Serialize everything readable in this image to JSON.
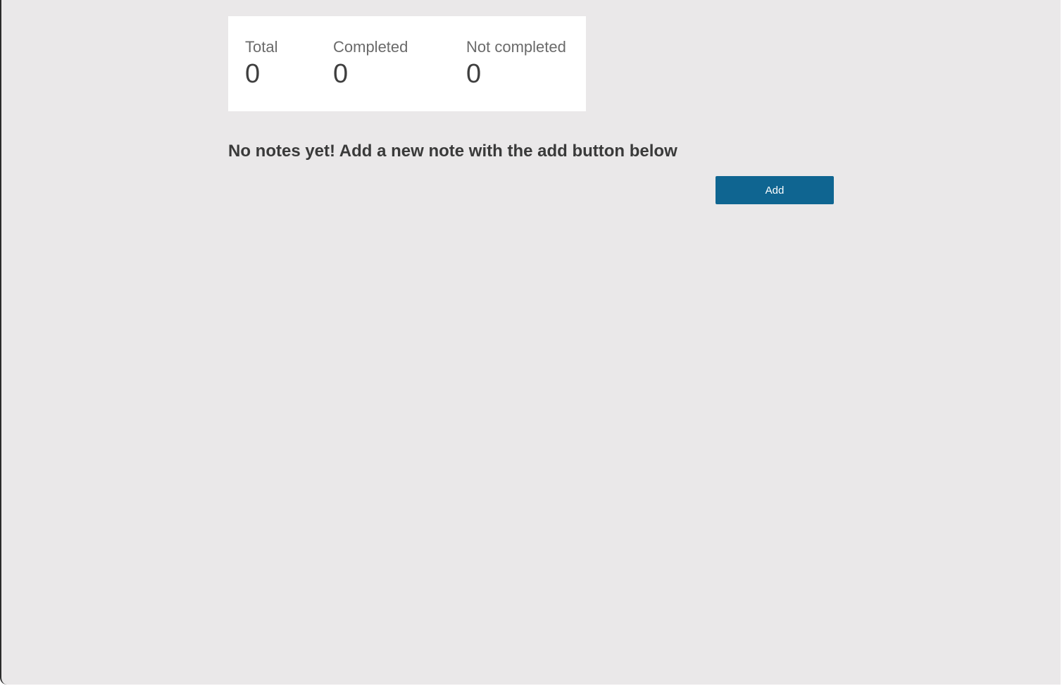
{
  "stats": {
    "total": {
      "label": "Total",
      "value": "0"
    },
    "completed": {
      "label": "Completed",
      "value": "0"
    },
    "not_completed": {
      "label": "Not completed",
      "value": "0"
    }
  },
  "empty_state": {
    "message": "No notes yet! Add a new note with the add button below"
  },
  "actions": {
    "add_label": "Add"
  },
  "colors": {
    "background": "#eae8e9",
    "card": "#ffffff",
    "accent": "#0f6591",
    "text_dark": "#3a3a3a",
    "text_muted": "#6a6a6a"
  }
}
